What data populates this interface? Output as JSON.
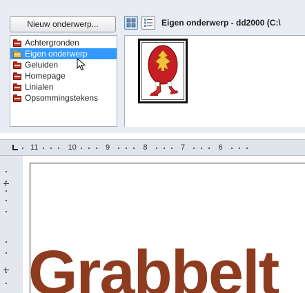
{
  "gallery": {
    "new_theme_label": "Nieuw onderwerp...",
    "title": "Eigen onderwerp - dd2000 (C:\\",
    "themes": [
      {
        "label": "Achtergronden",
        "selected": false
      },
      {
        "label": "Eigen onderwerp",
        "selected": true
      },
      {
        "label": "Geluiden",
        "selected": false
      },
      {
        "label": "Homepage",
        "selected": false
      },
      {
        "label": "Linialen",
        "selected": false
      },
      {
        "label": "Opsommingstekens",
        "selected": false
      }
    ],
    "view_buttons": [
      "icon-view-icon",
      "detail-view-icon"
    ]
  },
  "ruler": {
    "numbers": [
      "11",
      "10",
      "9",
      "8",
      "7",
      "6"
    ]
  },
  "document": {
    "visible_text": "Grabbelt"
  },
  "colors": {
    "selection": "#3399ff",
    "doc_text": "#8e3b1f",
    "panel_bg": "#e9edf3"
  }
}
